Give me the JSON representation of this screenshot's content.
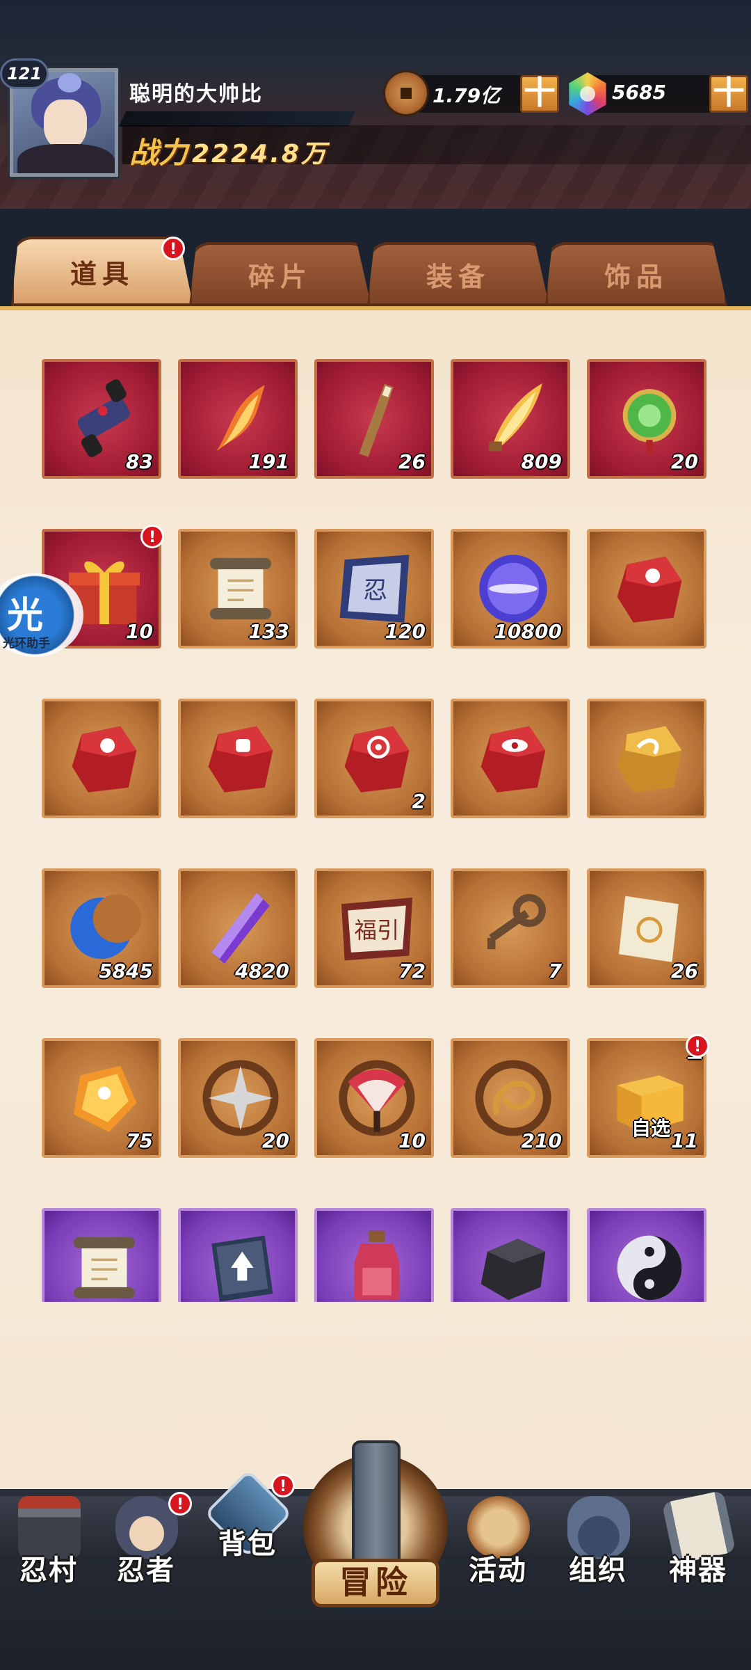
{
  "player": {
    "level": "121",
    "name": "聪明的大帅比",
    "power_label": "战力",
    "power_value": "2224.8万"
  },
  "resources": {
    "coins": "1.79亿",
    "gems": "5685",
    "plus": "十"
  },
  "tabs": [
    {
      "label": "道具",
      "active": true,
      "badge": "!"
    },
    {
      "label": "碎片",
      "active": false
    },
    {
      "label": "装备",
      "active": false
    },
    {
      "label": "饰品",
      "active": false
    }
  ],
  "items": [
    [
      {
        "icon": "scroll-bundle-icon",
        "qty": "83",
        "bg": "red"
      },
      {
        "icon": "flame-feather-icon",
        "qty": "191",
        "bg": "red"
      },
      {
        "icon": "wooden-stick-icon",
        "qty": "26",
        "bg": "red"
      },
      {
        "icon": "golden-feather-icon",
        "qty": "809",
        "bg": "red"
      },
      {
        "icon": "jade-pendant-icon",
        "qty": "20",
        "bg": "red"
      }
    ],
    [
      {
        "icon": "gift-box-icon",
        "qty": "10",
        "bg": "red",
        "badge": "!"
      },
      {
        "icon": "scroll-icon",
        "qty": "133",
        "bg": "orange"
      },
      {
        "icon": "seal-banner-icon",
        "qty": "120",
        "bg": "orange"
      },
      {
        "icon": "purple-orb-icon",
        "qty": "10800",
        "bg": "orange"
      },
      {
        "icon": "red-stone-icon",
        "qty": "",
        "bg": "orange"
      }
    ],
    [
      {
        "icon": "red-stone-icon",
        "qty": "",
        "bg": "orange"
      },
      {
        "icon": "red-stone-fist-icon",
        "qty": "",
        "bg": "orange"
      },
      {
        "icon": "red-stone-target-icon",
        "qty": "2",
        "bg": "orange"
      },
      {
        "icon": "red-stone-eye-icon",
        "qty": "",
        "bg": "orange"
      },
      {
        "icon": "gold-stone-icon",
        "qty": "",
        "bg": "orange"
      }
    ],
    [
      {
        "icon": "blue-moon-icon",
        "qty": "5845",
        "bg": "orange"
      },
      {
        "icon": "purple-crystal-icon",
        "qty": "4820",
        "bg": "orange"
      },
      {
        "icon": "fortune-ticket-icon",
        "qty": "72",
        "bg": "orange",
        "text": "福引"
      },
      {
        "icon": "key-icon",
        "qty": "7",
        "bg": "orange"
      },
      {
        "icon": "paper-talisman-icon",
        "qty": "26",
        "bg": "orange"
      }
    ],
    [
      {
        "icon": "amber-gem-icon",
        "qty": "75",
        "bg": "orange"
      },
      {
        "icon": "shuriken-icon",
        "qty": "20",
        "bg": "orange"
      },
      {
        "icon": "fan-icon",
        "qty": "10",
        "bg": "orange"
      },
      {
        "icon": "rope-icon",
        "qty": "210",
        "bg": "orange"
      },
      {
        "icon": "treasure-chest-icon",
        "qty": "11",
        "bg": "orange",
        "select_label": "自选",
        "corner": "三",
        "badge": "!"
      }
    ],
    [
      {
        "icon": "scroll-icon",
        "qty": "",
        "bg": "purple"
      },
      {
        "icon": "skill-book-icon",
        "qty": "",
        "bg": "purple"
      },
      {
        "icon": "potion-jar-icon",
        "qty": "",
        "bg": "purple"
      },
      {
        "icon": "black-ore-icon",
        "qty": "",
        "bg": "purple"
      },
      {
        "icon": "yin-yang-icon",
        "qty": "",
        "bg": "purple"
      }
    ]
  ],
  "helper": {
    "label": "光环助手"
  },
  "bottom_nav": [
    {
      "label": "忍村",
      "icon": "village-gate-icon"
    },
    {
      "label": "忍者",
      "icon": "ninja-head-icon",
      "badge": "!"
    },
    {
      "label": "背包",
      "icon": "backpack-icon",
      "badge": "!"
    },
    {
      "label": "冒险",
      "icon": "adventure-scroll-icon"
    },
    {
      "label": "活动",
      "icon": "activity-drum-icon"
    },
    {
      "label": "组织",
      "icon": "organization-icon"
    },
    {
      "label": "神器",
      "icon": "artifact-scroll-icon"
    }
  ],
  "colors": {
    "red_slot": "#a01b34",
    "orange_slot": "#b66f34",
    "purple_slot": "#7b3db8",
    "badge": "#d8141e",
    "gold_text": "#f5c34a"
  }
}
